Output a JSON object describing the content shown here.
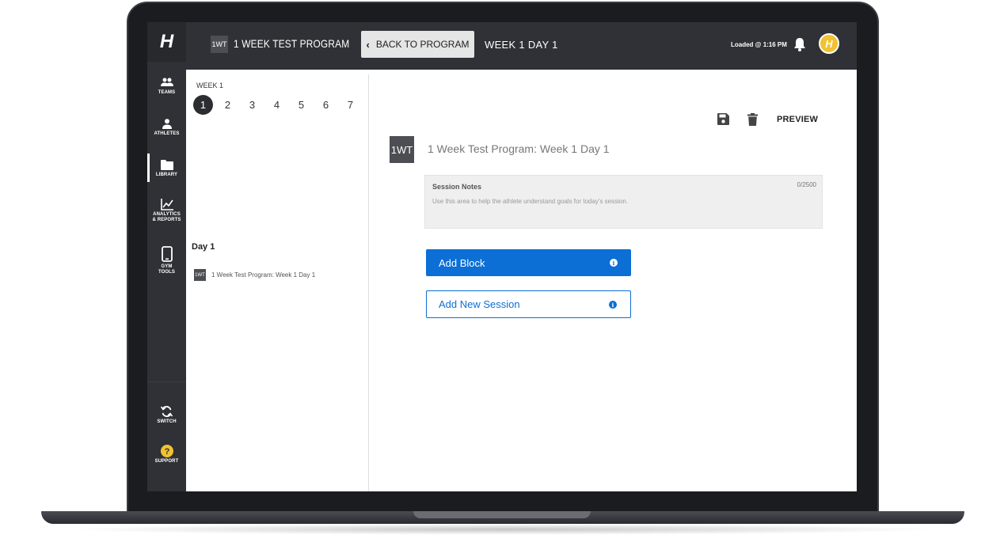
{
  "rail": {
    "logo": "H",
    "items": [
      {
        "label": "TEAMS",
        "icon": "people-icon"
      },
      {
        "label": "ATHLETES",
        "icon": "person-icon"
      },
      {
        "label": "LIBRARY",
        "icon": "folder-icon"
      },
      {
        "label": "ANALYTICS\n& REPORTS",
        "icon": "chart-icon"
      },
      {
        "label": "GYM\nTOOLS",
        "icon": "tablet-icon"
      }
    ],
    "bottom_items": [
      {
        "label": "SWITCH",
        "icon": "sync-icon"
      },
      {
        "label": "SUPPORT",
        "icon": "help-icon"
      }
    ]
  },
  "topbar": {
    "program_badge": "1WT",
    "program_title": "1 WEEK TEST PROGRAM",
    "back_label": "BACK TO PROGRAM",
    "page_title": "WEEK 1 DAY 1",
    "loaded_text": "Loaded @ 1:16 PM",
    "avatar_letter": "H"
  },
  "week_panel": {
    "week_label": "WEEK 1",
    "days": [
      "1",
      "2",
      "3",
      "4",
      "5",
      "6",
      "7"
    ],
    "active_day": "1",
    "day_title": "Day 1",
    "session_badge": "1WT",
    "session_name": "1 Week Test Program: Week 1 Day 1"
  },
  "main": {
    "preview_label": "PREVIEW",
    "badge": "1WT",
    "title": "1 Week Test Program: Week 1 Day 1",
    "notes": {
      "label": "Session Notes",
      "count": "0/2500",
      "placeholder": "Use this area to help the athlete understand goals for today's session."
    },
    "add_block_label": "Add Block",
    "add_session_label": "Add New Session",
    "info_glyph": "i"
  },
  "colors": {
    "primary": "#0b6fd6",
    "nav_dark": "#2f3136",
    "avatar": "#f2c230"
  }
}
